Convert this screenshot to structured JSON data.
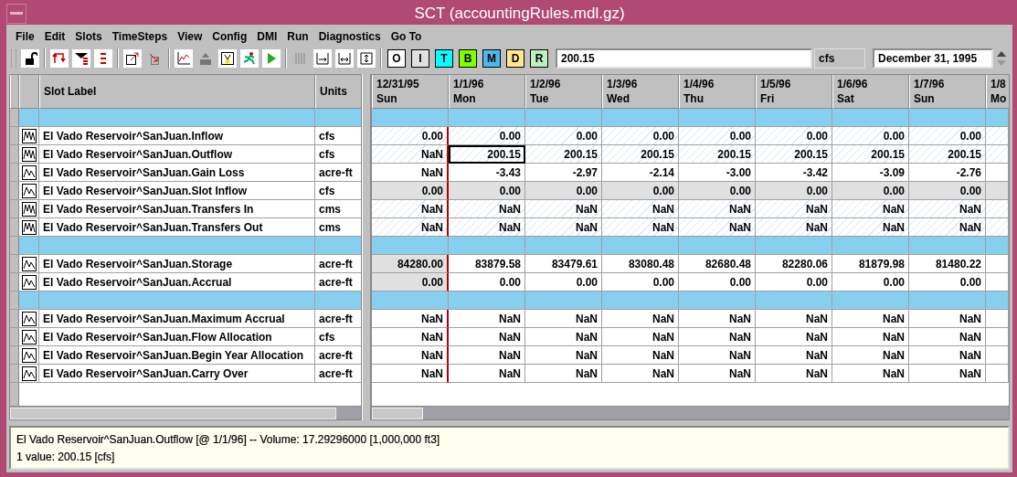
{
  "window": {
    "title": "SCT  (accountingRules.mdl.gz)"
  },
  "menu": [
    "File",
    "Edit",
    "Slots",
    "TimeSteps",
    "View",
    "Config",
    "DMI",
    "Run",
    "Diagnostics",
    "Go To"
  ],
  "toolbar": {
    "letter_buttons": [
      {
        "label": "O",
        "color": "#ffffff"
      },
      {
        "label": "I",
        "color": "#e0e0e0"
      },
      {
        "label": "T",
        "color": "#00ffff"
      },
      {
        "label": "B",
        "color": "#80ff00"
      },
      {
        "label": "M",
        "color": "#4cb8ec"
      },
      {
        "label": "D",
        "color": "#ffe890"
      },
      {
        "label": "R",
        "color": "#c0f0c0"
      }
    ],
    "value_field": "200.15",
    "units": "cfs",
    "date_field": "December 31, 1995"
  },
  "table": {
    "columns": [
      "Slot Label",
      "Units"
    ],
    "dates": [
      {
        "date": "12/31/95",
        "day": "Sun"
      },
      {
        "date": "1/1/96",
        "day": "Mon"
      },
      {
        "date": "1/2/96",
        "day": "Tue"
      },
      {
        "date": "1/3/96",
        "day": "Wed"
      },
      {
        "date": "1/4/96",
        "day": "Thu"
      },
      {
        "date": "1/5/96",
        "day": "Fri"
      },
      {
        "date": "1/6/96",
        "day": "Sat"
      },
      {
        "date": "1/7/96",
        "day": "Sun"
      },
      {
        "date": "1/8",
        "day": "Mo"
      }
    ],
    "rows": [
      {
        "kind": "separator"
      },
      {
        "kind": "slot",
        "multi_series": true,
        "hatched": true,
        "greyed": false,
        "first_greyed": false,
        "label": "El Vado Reservoir^SanJuan.Inflow",
        "units": "cfs",
        "cells": [
          {
            "text": "0.00",
            "selected": false
          },
          {
            "text": "0.00",
            "selected": false
          },
          {
            "text": "0.00",
            "selected": false
          },
          {
            "text": "0.00",
            "selected": false
          },
          {
            "text": "0.00",
            "selected": false
          },
          {
            "text": "0.00",
            "selected": false
          },
          {
            "text": "0.00",
            "selected": false
          },
          {
            "text": "0.00",
            "selected": false
          }
        ]
      },
      {
        "kind": "slot",
        "multi_series": true,
        "hatched": true,
        "greyed": false,
        "first_greyed": false,
        "label": "El Vado Reservoir^SanJuan.Outflow",
        "units": "cfs",
        "cells": [
          {
            "text": "NaN",
            "selected": false
          },
          {
            "text": "200.15",
            "selected": true
          },
          {
            "text": "200.15",
            "selected": false
          },
          {
            "text": "200.15",
            "selected": false
          },
          {
            "text": "200.15",
            "selected": false
          },
          {
            "text": "200.15",
            "selected": false
          },
          {
            "text": "200.15",
            "selected": false
          },
          {
            "text": "200.15",
            "selected": false
          }
        ]
      },
      {
        "kind": "slot",
        "multi_series": false,
        "hatched": false,
        "greyed": false,
        "first_greyed": false,
        "label": "El Vado Reservoir^SanJuan.Gain Loss",
        "units": "acre-ft",
        "cells": [
          {
            "text": "NaN",
            "selected": false
          },
          {
            "text": "-3.43",
            "selected": false
          },
          {
            "text": "-2.97",
            "selected": false
          },
          {
            "text": "-2.14",
            "selected": false
          },
          {
            "text": "-3.00",
            "selected": false
          },
          {
            "text": "-3.42",
            "selected": false
          },
          {
            "text": "-3.09",
            "selected": false
          },
          {
            "text": "-2.76",
            "selected": false
          }
        ]
      },
      {
        "kind": "slot",
        "multi_series": false,
        "hatched": false,
        "greyed": true,
        "first_greyed": true,
        "label": "El Vado Reservoir^SanJuan.Slot Inflow",
        "units": "cfs",
        "cells": [
          {
            "text": "0.00",
            "selected": false
          },
          {
            "text": "0.00",
            "selected": false
          },
          {
            "text": "0.00",
            "selected": false
          },
          {
            "text": "0.00",
            "selected": false
          },
          {
            "text": "0.00",
            "selected": false
          },
          {
            "text": "0.00",
            "selected": false
          },
          {
            "text": "0.00",
            "selected": false
          },
          {
            "text": "0.00",
            "selected": false
          }
        ]
      },
      {
        "kind": "slot",
        "multi_series": true,
        "hatched": true,
        "greyed": false,
        "first_greyed": false,
        "label": "El Vado Reservoir^SanJuan.Transfers In",
        "units": "cms",
        "cells": [
          {
            "text": "NaN",
            "selected": false
          },
          {
            "text": "NaN",
            "selected": false
          },
          {
            "text": "NaN",
            "selected": false
          },
          {
            "text": "NaN",
            "selected": false
          },
          {
            "text": "NaN",
            "selected": false
          },
          {
            "text": "NaN",
            "selected": false
          },
          {
            "text": "NaN",
            "selected": false
          },
          {
            "text": "NaN",
            "selected": false
          }
        ]
      },
      {
        "kind": "slot",
        "multi_series": true,
        "hatched": true,
        "greyed": false,
        "first_greyed": false,
        "label": "El Vado Reservoir^SanJuan.Transfers Out",
        "units": "cms",
        "cells": [
          {
            "text": "NaN",
            "selected": false
          },
          {
            "text": "NaN",
            "selected": false
          },
          {
            "text": "NaN",
            "selected": false
          },
          {
            "text": "NaN",
            "selected": false
          },
          {
            "text": "NaN",
            "selected": false
          },
          {
            "text": "NaN",
            "selected": false
          },
          {
            "text": "NaN",
            "selected": false
          },
          {
            "text": "NaN",
            "selected": false
          }
        ]
      },
      {
        "kind": "separator"
      },
      {
        "kind": "slot",
        "multi_series": false,
        "hatched": false,
        "greyed": false,
        "first_greyed": true,
        "label": "El Vado Reservoir^SanJuan.Storage",
        "units": "acre-ft",
        "cells": [
          {
            "text": "84280.00",
            "selected": false
          },
          {
            "text": "83879.58",
            "selected": false
          },
          {
            "text": "83479.61",
            "selected": false
          },
          {
            "text": "83080.48",
            "selected": false
          },
          {
            "text": "82680.48",
            "selected": false
          },
          {
            "text": "82280.06",
            "selected": false
          },
          {
            "text": "81879.98",
            "selected": false
          },
          {
            "text": "81480.22",
            "selected": false
          }
        ]
      },
      {
        "kind": "slot",
        "multi_series": false,
        "hatched": false,
        "greyed": false,
        "first_greyed": true,
        "label": "El Vado Reservoir^SanJuan.Accrual",
        "units": "acre-ft",
        "cells": [
          {
            "text": "0.00",
            "selected": false
          },
          {
            "text": "0.00",
            "selected": false
          },
          {
            "text": "0.00",
            "selected": false
          },
          {
            "text": "0.00",
            "selected": false
          },
          {
            "text": "0.00",
            "selected": false
          },
          {
            "text": "0.00",
            "selected": false
          },
          {
            "text": "0.00",
            "selected": false
          },
          {
            "text": "0.00",
            "selected": false
          }
        ]
      },
      {
        "kind": "separator"
      },
      {
        "kind": "slot",
        "multi_series": false,
        "hatched": false,
        "greyed": false,
        "first_greyed": false,
        "label": "El Vado Reservoir^SanJuan.Maximum Accrual",
        "units": "acre-ft",
        "cells": [
          {
            "text": "NaN",
            "selected": false
          },
          {
            "text": "NaN",
            "selected": false
          },
          {
            "text": "NaN",
            "selected": false
          },
          {
            "text": "NaN",
            "selected": false
          },
          {
            "text": "NaN",
            "selected": false
          },
          {
            "text": "NaN",
            "selected": false
          },
          {
            "text": "NaN",
            "selected": false
          },
          {
            "text": "NaN",
            "selected": false
          }
        ]
      },
      {
        "kind": "slot",
        "multi_series": false,
        "hatched": false,
        "greyed": false,
        "first_greyed": false,
        "label": "El Vado Reservoir^SanJuan.Flow Allocation",
        "units": "cfs",
        "cells": [
          {
            "text": "NaN",
            "selected": false
          },
          {
            "text": "NaN",
            "selected": false
          },
          {
            "text": "NaN",
            "selected": false
          },
          {
            "text": "NaN",
            "selected": false
          },
          {
            "text": "NaN",
            "selected": false
          },
          {
            "text": "NaN",
            "selected": false
          },
          {
            "text": "NaN",
            "selected": false
          },
          {
            "text": "NaN",
            "selected": false
          }
        ]
      },
      {
        "kind": "slot",
        "multi_series": false,
        "hatched": false,
        "greyed": false,
        "first_greyed": false,
        "label": "El Vado Reservoir^SanJuan.Begin Year Allocation",
        "units": "acre-ft",
        "cells": [
          {
            "text": "NaN",
            "selected": false
          },
          {
            "text": "NaN",
            "selected": false
          },
          {
            "text": "NaN",
            "selected": false
          },
          {
            "text": "NaN",
            "selected": false
          },
          {
            "text": "NaN",
            "selected": false
          },
          {
            "text": "NaN",
            "selected": false
          },
          {
            "text": "NaN",
            "selected": false
          },
          {
            "text": "NaN",
            "selected": false
          }
        ]
      },
      {
        "kind": "slot",
        "multi_series": false,
        "hatched": false,
        "greyed": false,
        "first_greyed": false,
        "label": "El Vado Reservoir^SanJuan.Carry Over",
        "units": "acre-ft",
        "cells": [
          {
            "text": "NaN",
            "selected": false
          },
          {
            "text": "NaN",
            "selected": false
          },
          {
            "text": "NaN",
            "selected": false
          },
          {
            "text": "NaN",
            "selected": false
          },
          {
            "text": "NaN",
            "selected": false
          },
          {
            "text": "NaN",
            "selected": false
          },
          {
            "text": "NaN",
            "selected": false
          },
          {
            "text": "NaN",
            "selected": false
          }
        ]
      }
    ]
  },
  "status": [
    "El Vado Reservoir^SanJuan.Outflow [@ 1/1/96] -- Volume: 17.29296000 [1,000,000 ft3]",
    "1 value:  200.15 [cfs]"
  ]
}
